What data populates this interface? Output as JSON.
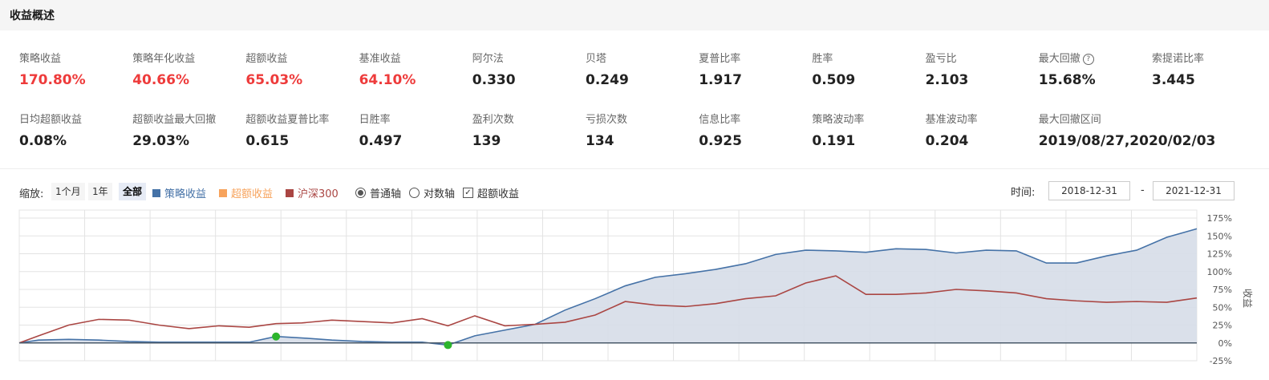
{
  "header": {
    "title": "收益概述"
  },
  "metrics_row1": [
    {
      "label": "策略收益",
      "value": "170.80%",
      "red": true
    },
    {
      "label": "策略年化收益",
      "value": "40.66%",
      "red": true
    },
    {
      "label": "超额收益",
      "value": "65.03%",
      "red": true
    },
    {
      "label": "基准收益",
      "value": "64.10%",
      "red": true
    },
    {
      "label": "阿尔法",
      "value": "0.330"
    },
    {
      "label": "贝塔",
      "value": "0.249"
    },
    {
      "label": "夏普比率",
      "value": "1.917"
    },
    {
      "label": "胜率",
      "value": "0.509"
    },
    {
      "label": "盈亏比",
      "value": "2.103"
    },
    {
      "label": "最大回撤",
      "value": "15.68%",
      "help": "?"
    },
    {
      "label": "索提诺比率",
      "value": "3.445"
    }
  ],
  "metrics_row2": [
    {
      "label": "日均超额收益",
      "value": "0.08%"
    },
    {
      "label": "超额收益最大回撤",
      "value": "29.03%"
    },
    {
      "label": "超额收益夏普比率",
      "value": "0.615"
    },
    {
      "label": "日胜率",
      "value": "0.497"
    },
    {
      "label": "盈利次数",
      "value": "139"
    },
    {
      "label": "亏损次数",
      "value": "134"
    },
    {
      "label": "信息比率",
      "value": "0.925"
    },
    {
      "label": "策略波动率",
      "value": "0.191"
    },
    {
      "label": "基准波动率",
      "value": "0.204"
    },
    {
      "label": "最大回撤区间",
      "value": "2019/08/27,2020/02/03"
    }
  ],
  "toolbar": {
    "zoom_label": "缩放:",
    "zoom_options": [
      "1个月",
      "1年",
      "全部"
    ],
    "zoom_active": "全部",
    "legend": [
      {
        "name": "策略收益",
        "color": "#4572a7"
      },
      {
        "name": "超额收益",
        "color": "#f7a35c"
      },
      {
        "name": "沪深300",
        "color": "#aa4643"
      }
    ],
    "axis_normal": "普通轴",
    "axis_log": "对数轴",
    "excess_toggle": "超额收益",
    "time_label": "时间:",
    "date_start": "2018-12-31",
    "date_sep": "-",
    "date_end": "2021-12-31"
  },
  "chart_data": {
    "type": "area",
    "x_range": [
      "2018-12-31",
      "2021-12-31"
    ],
    "ylabel": "收益",
    "y_ticks": [
      "175%",
      "150%",
      "125%",
      "100%",
      "75%",
      "50%",
      "25%",
      "0%",
      "-25%"
    ],
    "ylim": [
      -25,
      175
    ],
    "grid": true,
    "series": [
      {
        "name": "策略收益",
        "color": "#4572a7",
        "fill": "#d6dde8",
        "x": [
          "2018-12-31",
          "2019-01-18",
          "2019-02-15",
          "2019-03-15",
          "2019-04-12",
          "2019-05-10",
          "2019-06-07",
          "2019-07-05",
          "2019-08-02",
          "2019-08-27",
          "2019-09-20",
          "2019-10-18",
          "2019-11-15",
          "2019-12-13",
          "2020-01-10",
          "2020-02-03",
          "2020-02-28",
          "2020-03-27",
          "2020-04-24",
          "2020-05-22",
          "2020-06-19",
          "2020-07-17",
          "2020-08-14",
          "2020-09-11",
          "2020-10-09",
          "2020-11-06",
          "2020-12-04",
          "2021-01-01",
          "2021-01-29",
          "2021-02-26",
          "2021-03-26",
          "2021-04-23",
          "2021-05-21",
          "2021-06-18",
          "2021-07-16",
          "2021-08-13",
          "2021-09-10",
          "2021-10-08",
          "2021-11-05",
          "2021-12-03",
          "2021-12-31"
        ],
        "y": [
          0,
          4,
          5,
          4,
          2,
          1,
          1,
          1,
          1,
          9,
          7,
          4,
          2,
          1,
          1,
          -3,
          10,
          18,
          26,
          46,
          62,
          80,
          92,
          97,
          103,
          111,
          124,
          130,
          129,
          127,
          132,
          131,
          126,
          130,
          129,
          112,
          112,
          122,
          130,
          148,
          160
        ]
      },
      {
        "name": "沪深300",
        "color": "#aa4643",
        "fill": "none",
        "x": [
          "2018-12-31",
          "2019-01-18",
          "2019-02-15",
          "2019-03-15",
          "2019-04-12",
          "2019-05-10",
          "2019-06-07",
          "2019-07-05",
          "2019-08-02",
          "2019-08-27",
          "2019-09-20",
          "2019-10-18",
          "2019-11-15",
          "2019-12-13",
          "2020-01-10",
          "2020-02-03",
          "2020-02-28",
          "2020-03-27",
          "2020-04-24",
          "2020-05-22",
          "2020-06-19",
          "2020-07-17",
          "2020-08-14",
          "2020-09-11",
          "2020-10-09",
          "2020-11-06",
          "2020-12-04",
          "2021-01-01",
          "2021-01-29",
          "2021-02-26",
          "2021-03-26",
          "2021-04-23",
          "2021-05-21",
          "2021-06-18",
          "2021-07-16",
          "2021-08-13",
          "2021-09-10",
          "2021-10-08",
          "2021-11-05",
          "2021-12-03",
          "2021-12-31"
        ],
        "y": [
          0,
          10,
          25,
          33,
          32,
          25,
          20,
          24,
          22,
          27,
          28,
          32,
          30,
          28,
          34,
          24,
          38,
          24,
          26,
          29,
          39,
          58,
          53,
          51,
          55,
          62,
          66,
          84,
          94,
          68,
          68,
          70,
          75,
          73,
          70,
          62,
          59,
          57,
          58,
          57,
          63
        ]
      }
    ],
    "markers": [
      {
        "x": "2019-08-27",
        "series": "策略收益",
        "color": "#2db52d"
      },
      {
        "x": "2020-02-03",
        "series": "策略收益",
        "color": "#2db52d"
      }
    ]
  }
}
